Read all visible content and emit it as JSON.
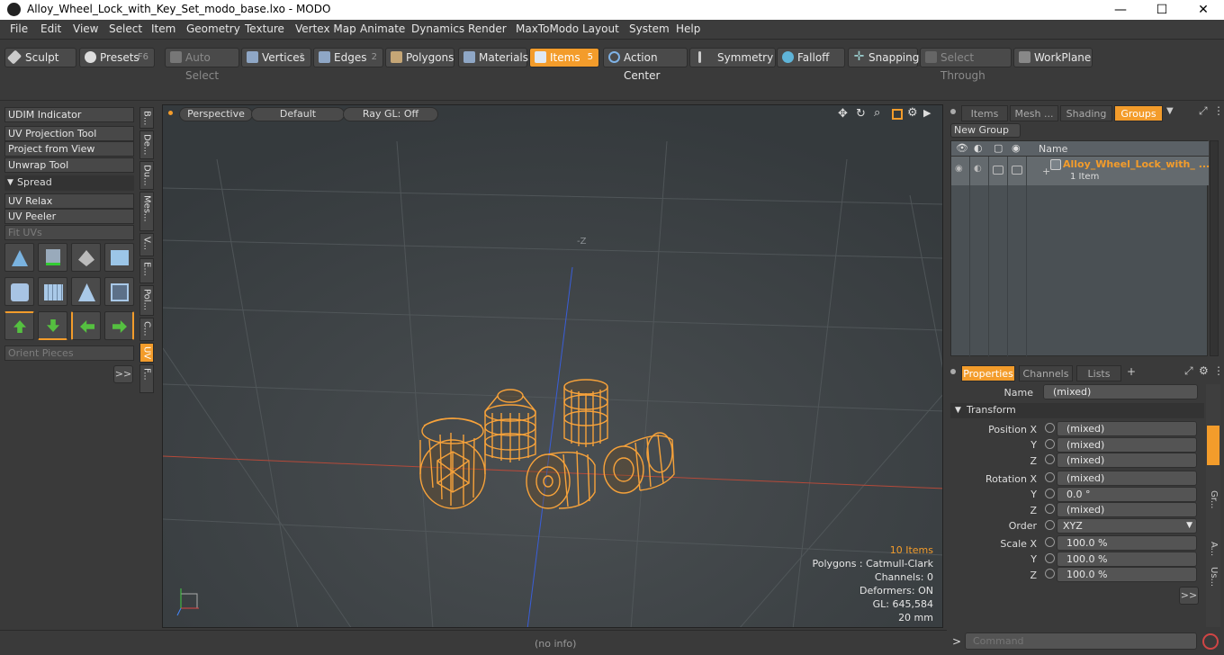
{
  "window": {
    "title": "Alloy_Wheel_Lock_with_Key_Set_modo_base.lxo - MODO",
    "minimize": "—",
    "maximize": "☐",
    "close": "✕"
  },
  "menu": [
    "File",
    "Edit",
    "View",
    "Select",
    "Item",
    "Geometry",
    "Texture",
    "Vertex Map",
    "Animate",
    "Dynamics",
    "Render",
    "MaxToModo",
    "Layout",
    "System",
    "Help"
  ],
  "toolbar": {
    "sculpt": "Sculpt",
    "presets": "Presets",
    "presets_key": "F6",
    "auto_select": "Auto Select",
    "vertices": "Vertices",
    "vertices_num": "1",
    "edges": "Edges",
    "edges_num": "2",
    "polygons": "Polygons",
    "materials": "Materials",
    "items": "Items",
    "items_num": "5",
    "action_center": "Action Center",
    "symmetry": "Symmetry",
    "falloff": "Falloff",
    "snapping": "Snapping",
    "select_through": "Select Through",
    "workplane": "WorkPlane"
  },
  "left_panel": {
    "udim": "UDIM Indicator",
    "uv_projection": "UV Projection Tool",
    "project_from_view": "Project from View",
    "unwrap": "Unwrap Tool",
    "spread": "Spread",
    "uv_relax": "UV Relax",
    "uv_peeler": "UV Peeler",
    "fit_uvs": "Fit UVs",
    "orient_pieces": "Orient Pieces",
    "more": ">>",
    "vtabs": [
      "B...",
      "De...",
      "Du...",
      "Mes...",
      "V...",
      "E...",
      "Pol...",
      "C...",
      "UV",
      "F..."
    ]
  },
  "viewport": {
    "mode": "Perspective",
    "shading": "Default",
    "raygl": "Ray GL: Off",
    "axis_label": "-Z",
    "info": {
      "items": "10 Items",
      "polygons": "Polygons : Catmull-Clark",
      "channels": "Channels: 0",
      "deformers": "Deformers: ON",
      "gl": "GL: 645,584",
      "scale": "20 mm"
    }
  },
  "status": {
    "text": "(no info)"
  },
  "groups_panel": {
    "tabs": [
      "Items",
      "Mesh ...",
      "Shading",
      "Groups"
    ],
    "new_group": "New Group",
    "col_name": "Name",
    "row_name": "Alloy_Wheel_Lock_with_ ...",
    "row_sub": "1 Item"
  },
  "properties_panel": {
    "tabs": [
      "Properties",
      "Channels",
      "Lists",
      "+"
    ],
    "name_label": "Name",
    "name_value": "(mixed)",
    "transform": "Transform",
    "position_x_label": "Position X",
    "position_x": "(mixed)",
    "position_y": "(mixed)",
    "position_z": "(mixed)",
    "rotation_x_label": "Rotation X",
    "rotation_x": "(mixed)",
    "rotation_y": "0.0 °",
    "rotation_z": "(mixed)",
    "order_label": "Order",
    "order_value": "XYZ",
    "scale_x_label": "Scale X",
    "scale_x": "100.0 %",
    "scale_y": "100.0 %",
    "scale_z": "100.0 %",
    "y": "Y",
    "z": "Z",
    "more": ">>",
    "side_tabs": [
      "Gr...",
      "A...",
      "Us..."
    ]
  },
  "command": {
    "prompt": ">",
    "placeholder": "Command"
  },
  "colors": {
    "accent": "#f39c2b",
    "wire": "#f7a23a"
  }
}
